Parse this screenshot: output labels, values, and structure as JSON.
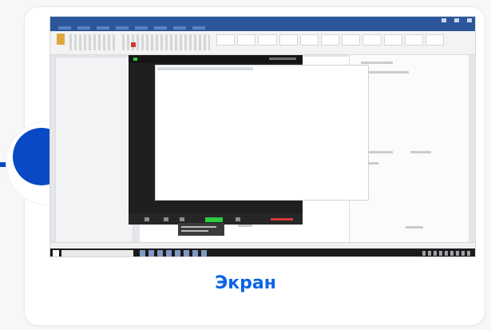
{
  "caption": "Экран",
  "colors": {
    "accent": "#0a49c6",
    "caption": "#0a64e8",
    "word_titlebar": "#2b579a",
    "zoom_background": "#1f1f1f",
    "zoom_active": "#2ecc40",
    "zoom_leave": "#d63b33"
  },
  "screenshot": {
    "apps": [
      "word-icon",
      "zoom-icon",
      "windows-taskbar-icon"
    ]
  }
}
